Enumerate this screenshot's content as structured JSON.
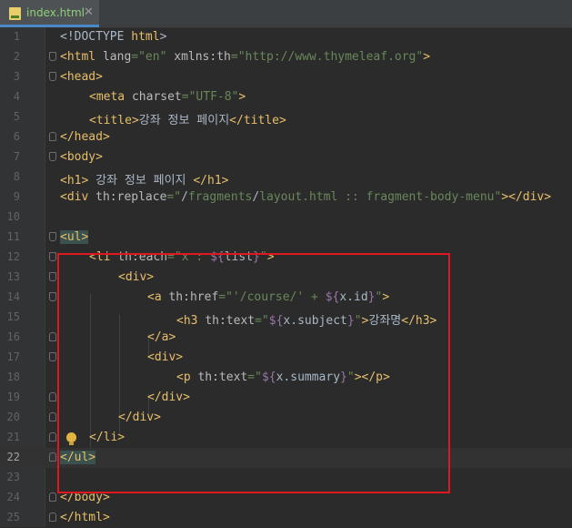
{
  "tab": {
    "icon": "html-file-icon",
    "label": "index.html",
    "close": "✕"
  },
  "lines": [
    {
      "n": "1",
      "text": "<!DOCTYPE html>"
    },
    {
      "n": "2",
      "text": "<html lang=\"en\" xmlns:th=\"http://www.thymeleaf.org\">"
    },
    {
      "n": "3",
      "text": "<head>"
    },
    {
      "n": "4",
      "text": "    <meta charset=\"UTF-8\">"
    },
    {
      "n": "5",
      "text": "    <title>강좌 정보 페이지</title>"
    },
    {
      "n": "6",
      "text": "</head>"
    },
    {
      "n": "7",
      "text": "<body>"
    },
    {
      "n": "8",
      "text": "<h1> 강좌 정보 페이지 </h1>"
    },
    {
      "n": "9",
      "text": "<div th:replace=\"/fragments/layout.html :: fragment-body-menu\"></div>"
    },
    {
      "n": "10",
      "text": ""
    },
    {
      "n": "11",
      "text": "<ul>"
    },
    {
      "n": "12",
      "text": "    <li th:each=\"x : ${list}\">"
    },
    {
      "n": "13",
      "text": "        <div>"
    },
    {
      "n": "14",
      "text": "            <a th:href=\"'/course/' + ${x.id}\">"
    },
    {
      "n": "15",
      "text": "                <h3 th:text=\"${x.subject}\">강좌명</h3>"
    },
    {
      "n": "16",
      "text": "            </a>"
    },
    {
      "n": "17",
      "text": "            <div>"
    },
    {
      "n": "18",
      "text": "                <p th:text=\"${x.summary}\"></p>"
    },
    {
      "n": "19",
      "text": "            </div>"
    },
    {
      "n": "20",
      "text": "        </div>"
    },
    {
      "n": "21",
      "text": "    </li>"
    },
    {
      "n": "22",
      "text": "</ul>"
    },
    {
      "n": "23",
      "text": ""
    },
    {
      "n": "24",
      "text": "</body>"
    },
    {
      "n": "25",
      "text": "</html>"
    }
  ],
  "current_line": "22",
  "intention_icon": "lightbulb-icon",
  "colors": {
    "background": "#2b2b2b",
    "tag": "#e8bf6a",
    "attribute": "#bababa",
    "string": "#6a8759",
    "expression": "#9876aa",
    "text": "#a9b7c6",
    "highlight_border": "#e0171e"
  }
}
